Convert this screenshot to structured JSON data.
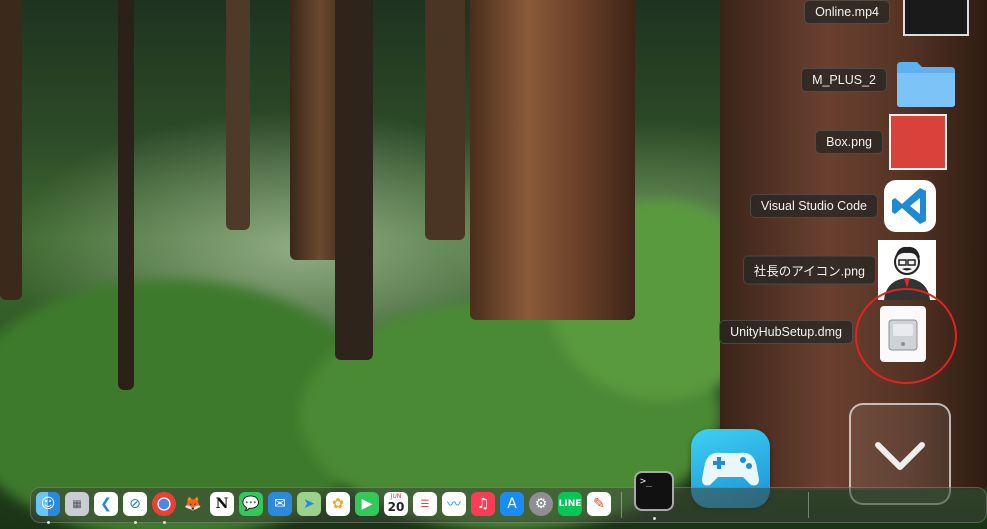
{
  "stack": {
    "items": [
      {
        "label": "Online.mp4",
        "kind": "video"
      },
      {
        "label": "M_PLUS_2",
        "kind": "folder"
      },
      {
        "label": "Box.png",
        "kind": "image",
        "color": "#d9413b"
      },
      {
        "label": "Visual Studio Code",
        "kind": "app",
        "color": "#1f8ad2"
      },
      {
        "label": "社長のアイコン.png",
        "kind": "image"
      },
      {
        "label": "UnityHubSetup.dmg",
        "kind": "disk-image"
      }
    ],
    "highlight_color": "#e0241f"
  },
  "dock": {
    "apps": [
      "finder",
      "launchpad",
      "vscode",
      "safari",
      "chrome",
      "gimp",
      "notion",
      "messages",
      "mail",
      "maps",
      "photos",
      "facetime",
      "calendar",
      "reminders",
      "stocks",
      "music",
      "app-store",
      "system-settings",
      "line",
      "pencil",
      "terminal"
    ],
    "calendar": {
      "month": "JUN",
      "day": "20"
    },
    "terminal_prompt": ">_"
  }
}
